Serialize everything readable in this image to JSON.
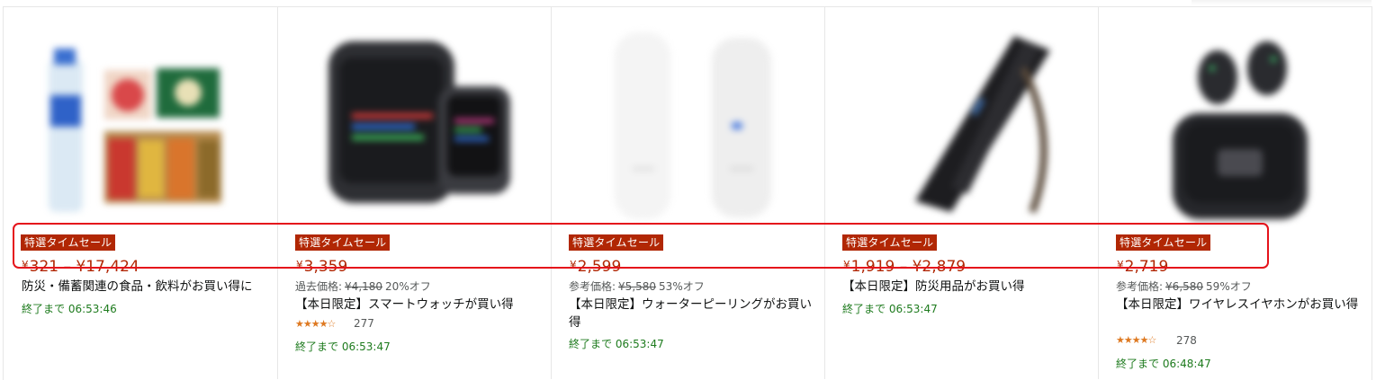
{
  "deals": [
    {
      "badge": "特選タイムセール",
      "price_yen": "¥",
      "price": "321 – ¥17,424",
      "title": "防災・備蓄関連の食品・飲料がお買い得に",
      "timer": "終了まで 06:53:46"
    },
    {
      "badge": "特選タイムセール",
      "price_yen": "¥",
      "price": "3,359",
      "ref_label": "過去価格:",
      "ref_price": "¥4,180",
      "discount": "20%オフ",
      "title": "【本日限定】スマートウォッチが買い得",
      "rating_value": 3.5,
      "rating_stars": "★★★★☆",
      "rating_count": "277",
      "timer": "終了まで 06:53:47"
    },
    {
      "badge": "特選タイムセール",
      "price_yen": "¥",
      "price": "2,599",
      "ref_label": "参考価格:",
      "ref_price": "¥5,580",
      "discount": "53%オフ",
      "title": "【本日限定】ウォーターピーリングがお買い得",
      "timer": "終了まで 06:53:47"
    },
    {
      "badge": "特選タイムセール",
      "price_yen": "¥",
      "price": "1,919 – ¥2,879",
      "title": "【本日限定】防災用品がお買い得",
      "timer": "終了まで 06:53:47"
    },
    {
      "badge": "特選タイムセール",
      "price_yen": "¥",
      "price": "2,719",
      "ref_label": "参考価格:",
      "ref_price": "¥6,580",
      "discount": "59%オフ",
      "title": "【本日限定】ワイヤレスイヤホンがお買い得",
      "rating_value": 4.5,
      "rating_stars": "★★★★☆",
      "rating_count": "278",
      "timer": "終了まで 06:48:47"
    }
  ],
  "colors": {
    "badge": "#b12704",
    "price": "#b12704",
    "timer": "#1e7b1e",
    "stars": "#de7921",
    "highlight": "#e5131b"
  }
}
